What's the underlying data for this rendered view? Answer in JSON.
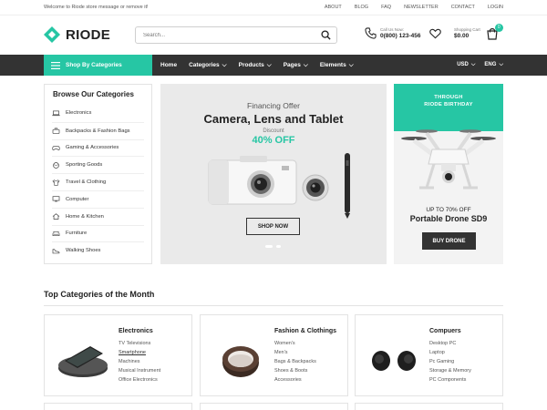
{
  "topbar": {
    "welcome": "Welcome to Riode store message or remove it!",
    "links": [
      "ABOUT",
      "BLOG",
      "FAQ",
      "NEWSLETTER",
      "CONTACT",
      "LOGIN"
    ]
  },
  "header": {
    "logo": "RIODE",
    "search_placeholder": "Search...",
    "call_label": "Call Us Now:",
    "call_number": "0(800) 123-456",
    "cart_label": "Shopping Cart",
    "cart_amount": "$0.00",
    "cart_count": "0"
  },
  "nav": {
    "categories_button": "Shop By Categories",
    "menu": [
      {
        "label": "Home",
        "caret": false
      },
      {
        "label": "Categories",
        "caret": true
      },
      {
        "label": "Products",
        "caret": true
      },
      {
        "label": "Pages",
        "caret": true
      },
      {
        "label": "Elements",
        "caret": true
      }
    ],
    "currency": "USD",
    "language": "ENG"
  },
  "sidebar": {
    "title": "Browse Our Categories",
    "items": [
      {
        "label": "Electronics",
        "icon": "laptop-icon"
      },
      {
        "label": "Backpacks & Fashion Bags",
        "icon": "bag-icon"
      },
      {
        "label": "Gaming & Accessories",
        "icon": "gamepad-icon"
      },
      {
        "label": "Sporting Goods",
        "icon": "ball-icon"
      },
      {
        "label": "Travel & Clothing",
        "icon": "shirt-icon"
      },
      {
        "label": "Computer",
        "icon": "monitor-icon"
      },
      {
        "label": "Home & Kitchen",
        "icon": "home-icon"
      },
      {
        "label": "Furniture",
        "icon": "sofa-icon"
      },
      {
        "label": "Walking Shoes",
        "icon": "shoe-icon"
      }
    ]
  },
  "hero": {
    "offer": "Financing Offer",
    "title": "Camera, Lens and Tablet",
    "discount_label": "Discount",
    "discount_value": "40% OFF",
    "button": "SHOP NOW"
  },
  "promo": {
    "line1": "THROUGH",
    "line2": "RIODE BIRTHDAY",
    "upto": "UP TO 70% OFF",
    "product": "Portable Drone SD9",
    "button": "BUY DRONE"
  },
  "top_categories": {
    "title": "Top Categories of the Month",
    "cards": [
      {
        "name": "Electronics",
        "items": [
          "TV Televisions",
          "Smartphone",
          "Machines",
          "Musical Instrument",
          "Office Electronics"
        ],
        "underlined": 1
      },
      {
        "name": "Fashion & Clothings",
        "items": [
          "Women's",
          "Men's",
          "Bags & Backpacks",
          "Shoes & Boots",
          "Accessories"
        ],
        "underlined": -1
      },
      {
        "name": "Compuers",
        "items": [
          "Desktop PC",
          "Laptop",
          "Pc Gaming",
          "Storage & Memory",
          "PC Components"
        ],
        "underlined": -1
      }
    ]
  },
  "colors": {
    "accent": "#26c6a4",
    "dark": "#333333"
  }
}
